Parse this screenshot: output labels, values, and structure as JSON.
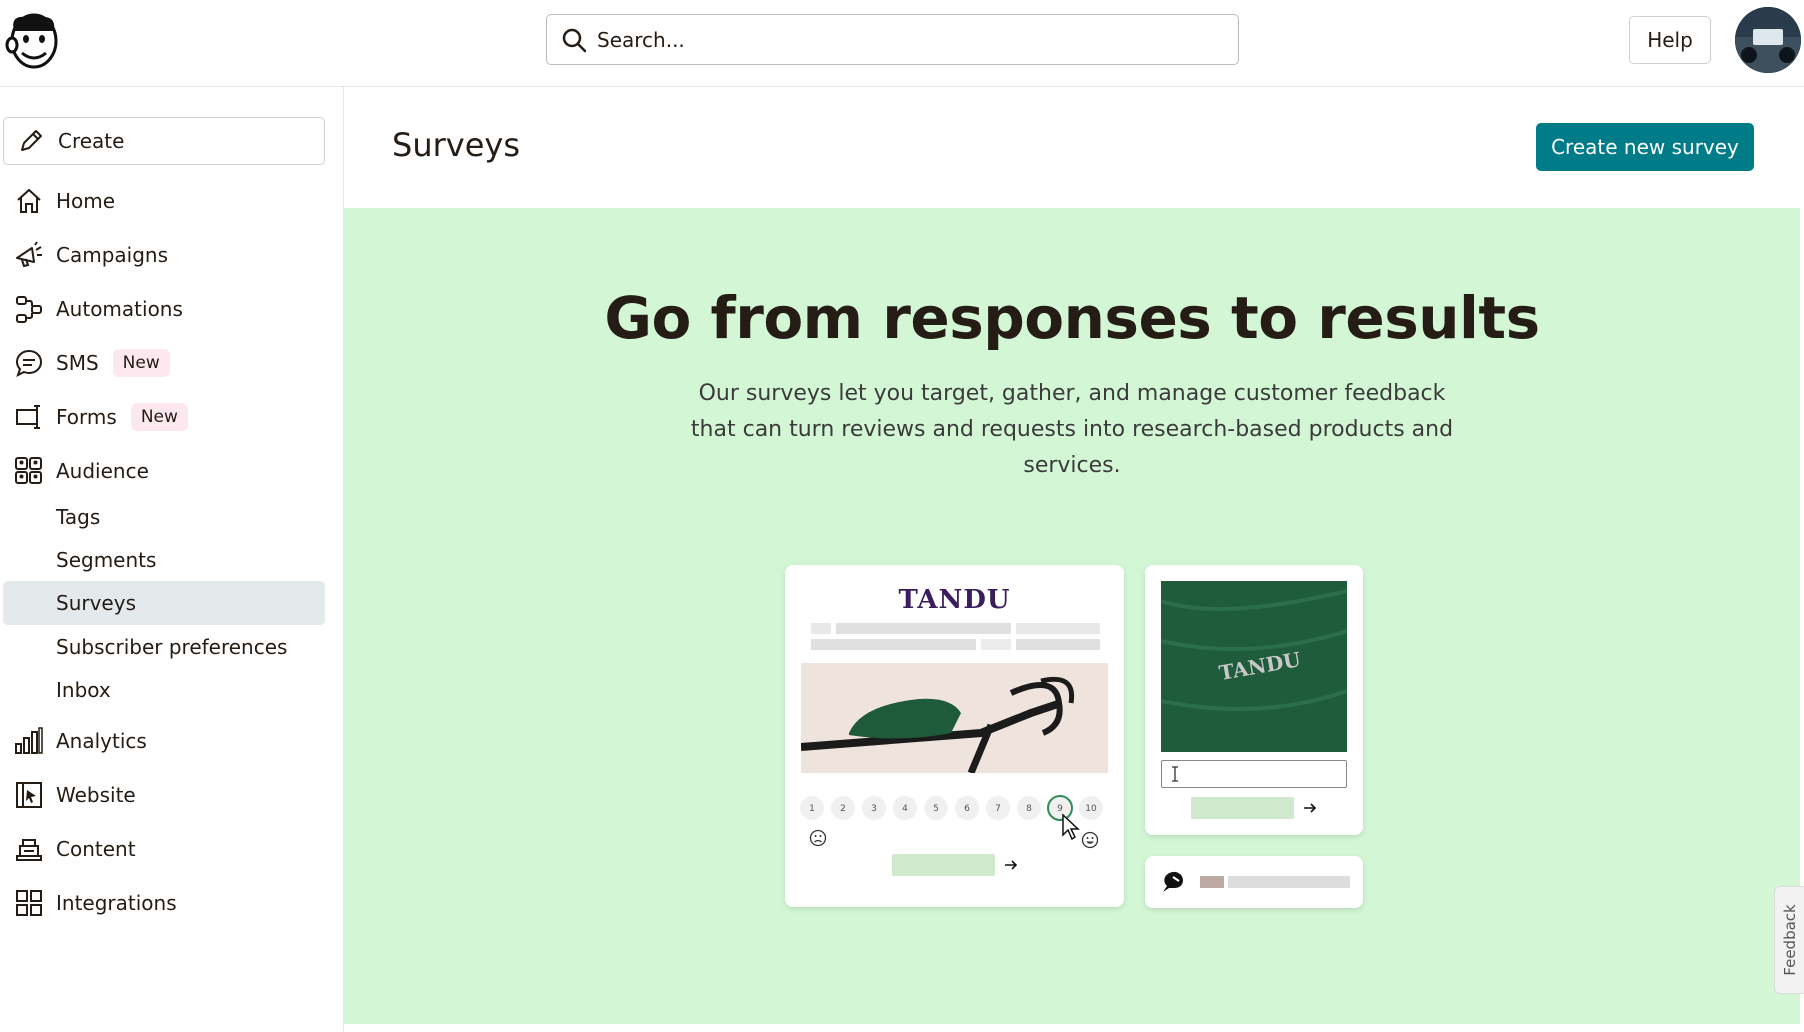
{
  "header": {
    "search_placeholder": "Search...",
    "help_label": "Help"
  },
  "sidebar": {
    "create_label": "Create",
    "items": [
      {
        "label": "Home",
        "icon": "home-icon"
      },
      {
        "label": "Campaigns",
        "icon": "megaphone-icon"
      },
      {
        "label": "Automations",
        "icon": "automations-icon"
      },
      {
        "label": "SMS",
        "icon": "chat-bubble-icon",
        "badge": "New"
      },
      {
        "label": "Forms",
        "icon": "form-icon",
        "badge": "New"
      },
      {
        "label": "Audience",
        "icon": "audience-icon"
      }
    ],
    "audience_sub": [
      {
        "label": "Tags"
      },
      {
        "label": "Segments"
      },
      {
        "label": "Surveys",
        "active": true
      },
      {
        "label": "Subscriber preferences"
      },
      {
        "label": "Inbox"
      }
    ],
    "items_bottom": [
      {
        "label": "Analytics",
        "icon": "bar-chart-icon"
      },
      {
        "label": "Website",
        "icon": "website-icon"
      },
      {
        "label": "Content",
        "icon": "content-icon"
      },
      {
        "label": "Integrations",
        "icon": "grid-icon"
      }
    ]
  },
  "main": {
    "title": "Surveys",
    "cta_label": "Create new survey",
    "hero": {
      "title": "Go from responses to results",
      "subtitle": "Our surveys let you target, gather, and manage customer feedback that can turn reviews and requests into research-based products and services."
    },
    "illustration": {
      "brand": "TANDU",
      "rating_scale": [
        "1",
        "2",
        "3",
        "4",
        "5",
        "6",
        "7",
        "8",
        "9",
        "10"
      ],
      "selected_rating": "9"
    }
  },
  "feedback_label": "Feedback",
  "colors": {
    "accent": "#007c89",
    "hero_bg": "#d3f7d5",
    "badge_bg": "#fde8f0",
    "active_bg": "#e4e9ec"
  }
}
